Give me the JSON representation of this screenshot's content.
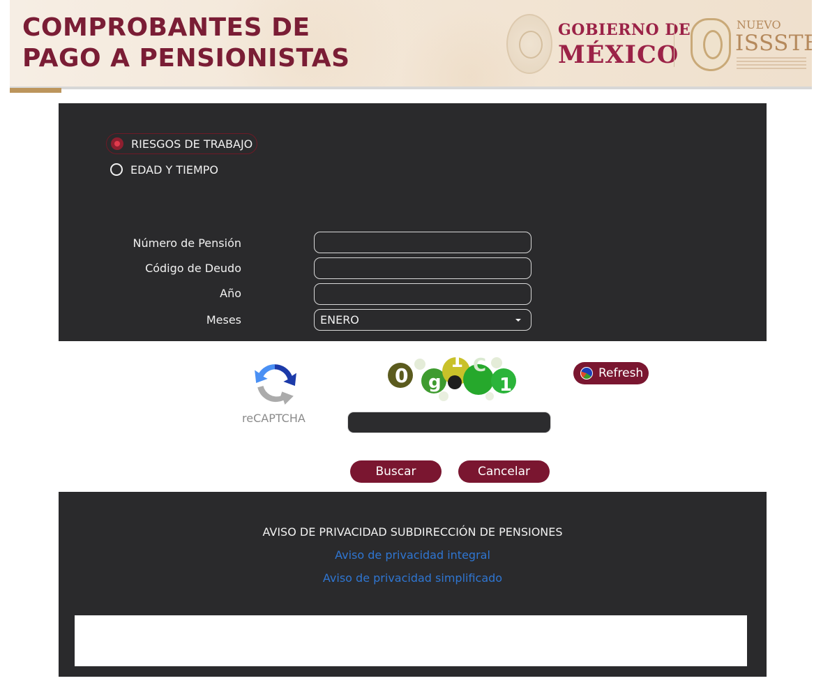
{
  "header": {
    "title_line1": "COMPROBANTES DE",
    "title_line2": "PAGO A PENSIONISTAS",
    "gobierno_line1": "GOBIERNO DE",
    "gobierno_line2": "MÉXICO",
    "issste_top": "NUEVO",
    "issste_name": "ISSSTE",
    "colors": {
      "title": "#7a1d35",
      "gobierno": "#9b2247",
      "issste": "#b5895c",
      "gold": "#bc955c"
    }
  },
  "form": {
    "radio_options": [
      {
        "label": "RIESGOS DE TRABAJO",
        "selected": true
      },
      {
        "label": "EDAD Y TIEMPO",
        "selected": false
      }
    ],
    "fields": {
      "pension_label": "Número de Pensión",
      "pension_value": "",
      "deudo_label": "Código de Deudo",
      "deudo_value": "",
      "anio_label": "Año",
      "anio_value": "",
      "meses_label": "Meses",
      "meses_value": "ENERO"
    }
  },
  "captcha": {
    "recaptcha_label": "reCAPTCHA",
    "captcha_text": "0g1C1",
    "refresh_label": "Refresh",
    "input_value": ""
  },
  "actions": {
    "buscar_label": "Buscar",
    "cancelar_label": "Cancelar",
    "button_color": "#7a1630"
  },
  "footer": {
    "privacy_title": "AVISO DE PRIVACIDAD SUBDIRECCIÓN DE PENSIONES",
    "link_integral": "Aviso de privacidad integral",
    "link_simplificado": "Aviso de privacidad simplificado",
    "link_color": "#2f76d2"
  }
}
